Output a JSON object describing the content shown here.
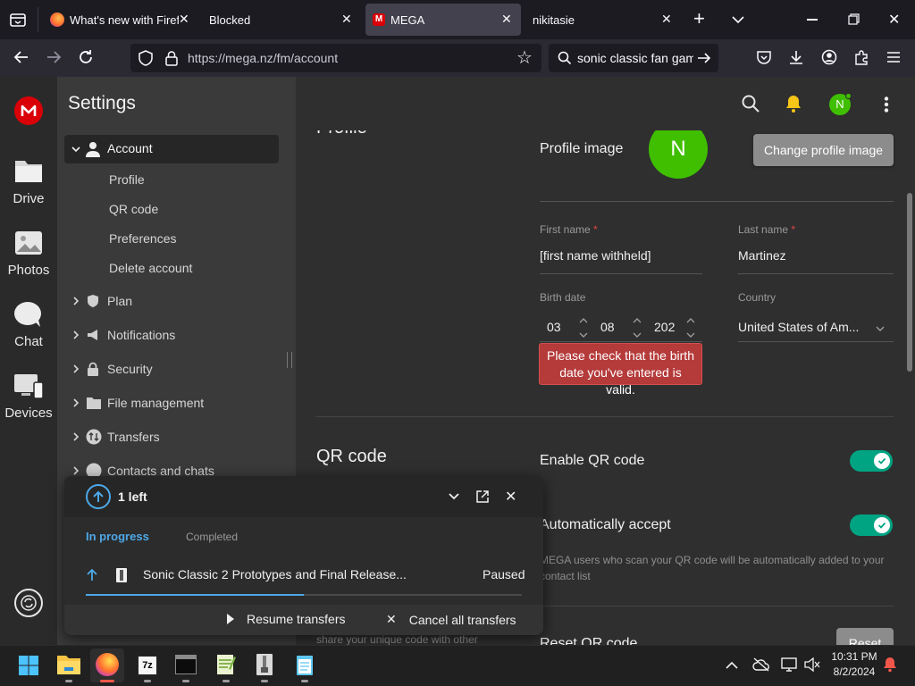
{
  "browser": {
    "tabs": [
      {
        "title": "What's new with Firefox",
        "selected": false
      },
      {
        "title": "Blocked",
        "selected": false
      },
      {
        "title": "MEGA",
        "selected": true
      },
      {
        "title": "nikitasie",
        "selected": false
      }
    ],
    "new_tab": "+",
    "url": "https://mega.nz/fm/account",
    "search_text": "sonic classic fan gam"
  },
  "leftnav": {
    "items": [
      {
        "label": "Drive",
        "icon": "folder-icon"
      },
      {
        "label": "Photos",
        "icon": "photos-icon"
      },
      {
        "label": "Chat",
        "icon": "chat-icon"
      },
      {
        "label": "Devices",
        "icon": "devices-icon"
      }
    ]
  },
  "settings": {
    "title": "Settings",
    "account": {
      "label": "Account",
      "subitems": [
        "Profile",
        "QR code",
        "Preferences",
        "Delete account"
      ]
    },
    "items": [
      "Plan",
      "Notifications",
      "Security",
      "File management",
      "Transfers",
      "Contacts and chats"
    ]
  },
  "header": {
    "avatar_letter": "N"
  },
  "profile": {
    "section_title": "Profile",
    "image_label": "Profile image",
    "avatar_letter": "N",
    "change_button": "Change profile image",
    "first_name_label": "First name",
    "first_name": "[first name withheld]",
    "last_name_label": "Last name",
    "last_name": "Martinez",
    "required_mark": "*",
    "birth_label": "Birth date",
    "birth_day": "03",
    "birth_month": "08",
    "birth_year": "202",
    "country_label": "Country",
    "country": "United States of Am...",
    "error": "Please check that the birth date you've entered is valid."
  },
  "qr": {
    "section_title": "QR code",
    "enable_label": "Enable QR code",
    "enable_on": true,
    "auto_label": "Automatically accept",
    "auto_on": true,
    "auto_desc": "MEGA users who scan your QR code will be automatically added to your contact list",
    "reset_label": "Reset QR code",
    "reset_button": "Reset",
    "share_text": "share your unique code with other"
  },
  "transfers": {
    "count": "1 left",
    "tab_in_progress": "In progress",
    "tab_completed": "Completed",
    "file_name": "Sonic Classic 2 Prototypes and Final Release...",
    "status": "Paused",
    "progress": 0.5,
    "resume": "Resume transfers",
    "cancel": "Cancel all transfers"
  },
  "taskbar": {
    "time": "10:31 PM",
    "date": "8/2/2024"
  },
  "colors": {
    "mega_red": "#d90007",
    "accent_green": "#00a382",
    "avatar_green": "#3fbf00",
    "error_red": "#c0392b",
    "progress_blue": "#4da8e8"
  }
}
